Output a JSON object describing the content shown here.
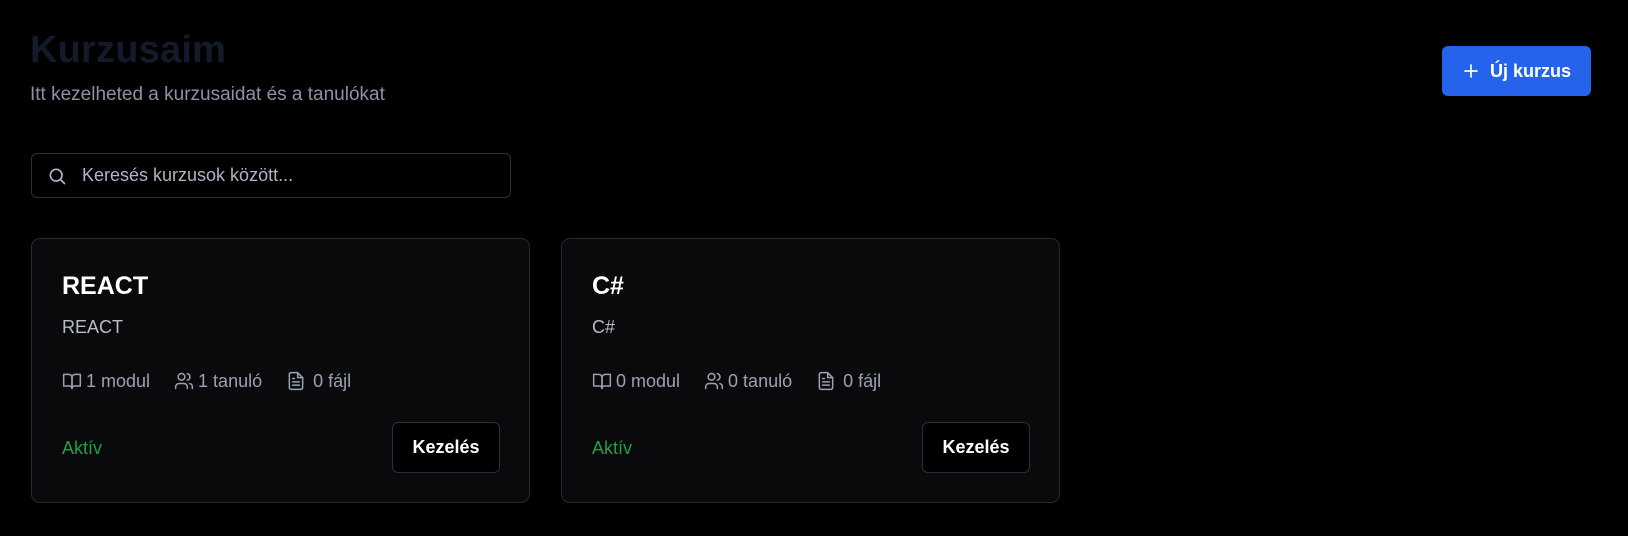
{
  "header": {
    "title": "Kurzusaim",
    "subtitle": "Itt kezelheted a kurzusaidat és a tanulókat",
    "new_course_label": "Új kurzus",
    "new_course_icon": "plus-icon"
  },
  "search": {
    "placeholder": "Keresés kurzusok között...",
    "value": "",
    "icon": "search-icon"
  },
  "colors": {
    "accent": "#2563eb",
    "status_active": "#22a047",
    "background": "#000000",
    "card_background": "#0a0a0c",
    "card_border": "#262a36"
  },
  "courses": [
    {
      "title": "REACT",
      "description": "REACT",
      "modules": "1 modul",
      "students": "1 tanuló",
      "files": "0 fájl",
      "status": "Aktív",
      "manage_label": "Kezelés"
    },
    {
      "title": "C#",
      "description": "C#",
      "modules": "0 modul",
      "students": "0 tanuló",
      "files": "0 fájl",
      "status": "Aktív",
      "manage_label": "Kezelés"
    }
  ],
  "icons": {
    "modules": "book-open-icon",
    "students": "users-icon",
    "files": "file-text-icon"
  }
}
